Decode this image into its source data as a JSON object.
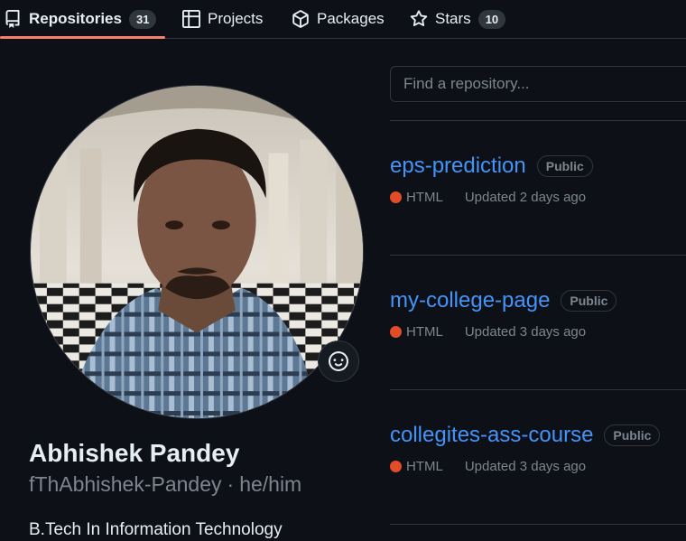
{
  "tabs": [
    {
      "label": "Repositories",
      "icon": "repo-icon",
      "count": "31",
      "active": true
    },
    {
      "label": "Projects",
      "icon": "table-icon",
      "count": null,
      "active": false
    },
    {
      "label": "Packages",
      "icon": "package-icon",
      "count": null,
      "active": false
    },
    {
      "label": "Stars",
      "icon": "star-icon",
      "count": "10",
      "active": false
    }
  ],
  "profile": {
    "name": "Abhishek Pandey",
    "username": "fThAbhishek-Pandey",
    "pronouns": "he/him",
    "bio": "B.Tech In Information Technology",
    "status_icon": "smiley-icon"
  },
  "search": {
    "placeholder": "Find a repository..."
  },
  "repos": [
    {
      "name": "eps-prediction",
      "visibility": "Public",
      "language": "HTML",
      "updated": "Updated 2 days ago"
    },
    {
      "name": "my-college-page",
      "visibility": "Public",
      "language": "HTML",
      "updated": "Updated 3 days ago"
    },
    {
      "name": "collegites-ass-course",
      "visibility": "Public",
      "language": "HTML",
      "updated": "Updated 3 days ago"
    }
  ],
  "colors": {
    "background": "#0d1117",
    "accent_underline": "#f78166",
    "link": "#4493f8",
    "html_language": "#e34c26",
    "muted_text": "#7d8590",
    "border": "#30363d"
  }
}
